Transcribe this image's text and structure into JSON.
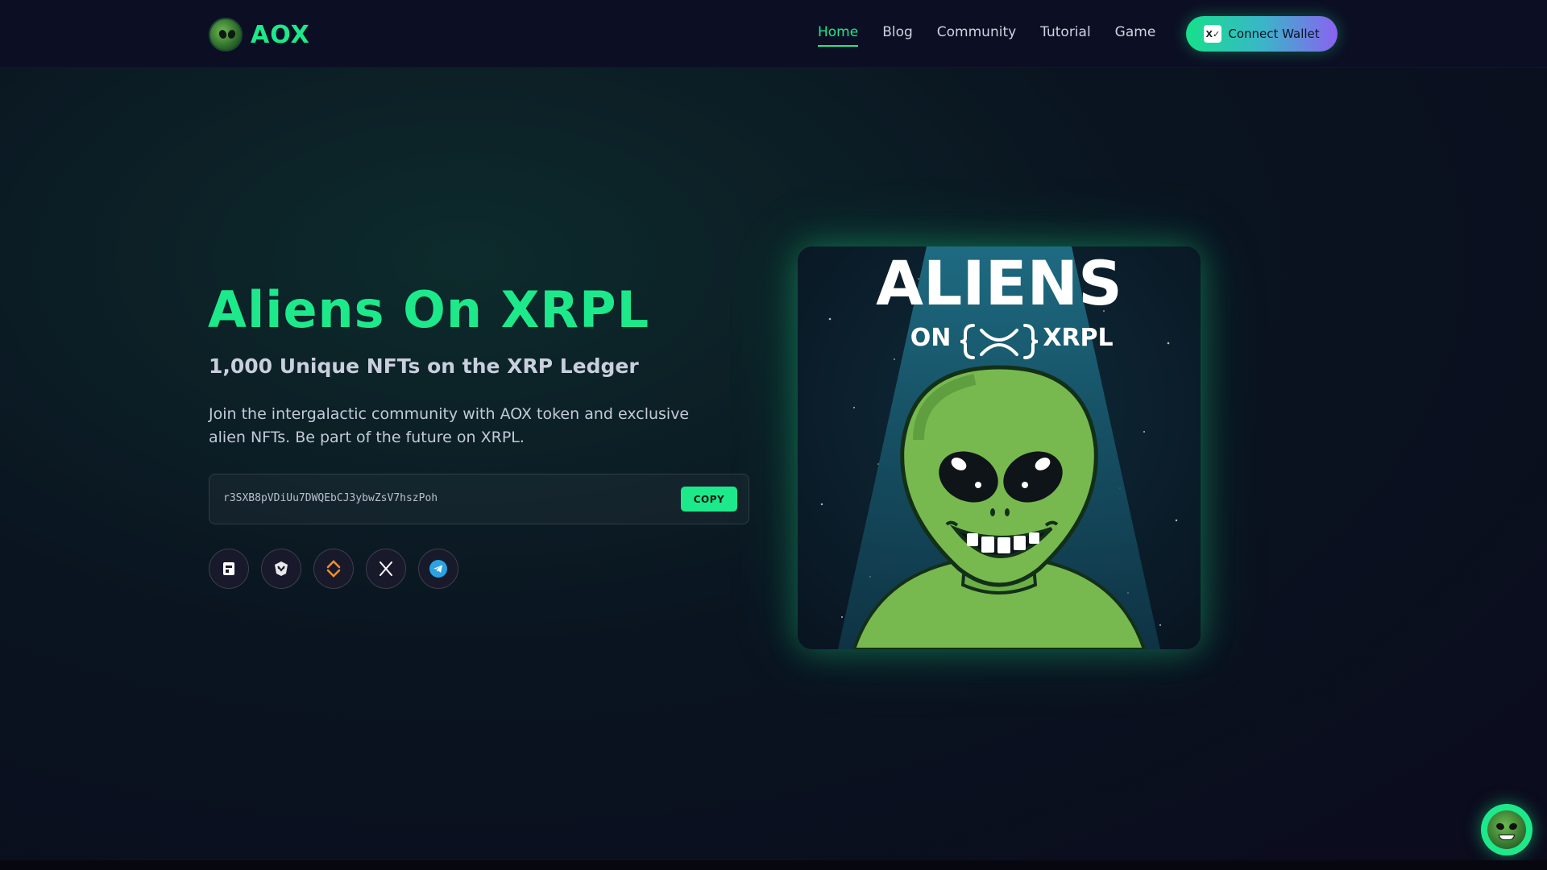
{
  "brand": {
    "name": "AOX",
    "logo_icon": "alien-head-icon"
  },
  "nav": {
    "links": [
      {
        "label": "Home",
        "active": true
      },
      {
        "label": "Blog",
        "active": false
      },
      {
        "label": "Community",
        "active": false
      },
      {
        "label": "Tutorial",
        "active": false
      },
      {
        "label": "Game",
        "active": false
      }
    ],
    "connect_label": "Connect Wallet",
    "wallet_icon_text": "X✓"
  },
  "hero": {
    "title": "Aliens On XRPL",
    "subtitle": "1,000 Unique NFTs on the XRP Ledger",
    "description": "Join the intergalactic community with AOX token and exclusive alien NFTs. Be part of the future on XRPL.",
    "address": "r3SXB8pVDiUu7DWQEbCJ3ybwZsV7hszPoh",
    "copy_label": "COPY",
    "art": {
      "line1": "ALIENS",
      "line2_left": "ON",
      "line2_right": "XRPL"
    }
  },
  "socials": [
    {
      "icon": "xpmarket-icon"
    },
    {
      "icon": "firstledger-icon"
    },
    {
      "icon": "sologenic-icon"
    },
    {
      "icon": "x-twitter-icon"
    },
    {
      "icon": "telegram-icon"
    }
  ],
  "colors": {
    "accent": "#1de98b",
    "nav_bg": "#0c0f24",
    "gradient_end": "#8a62f0"
  }
}
